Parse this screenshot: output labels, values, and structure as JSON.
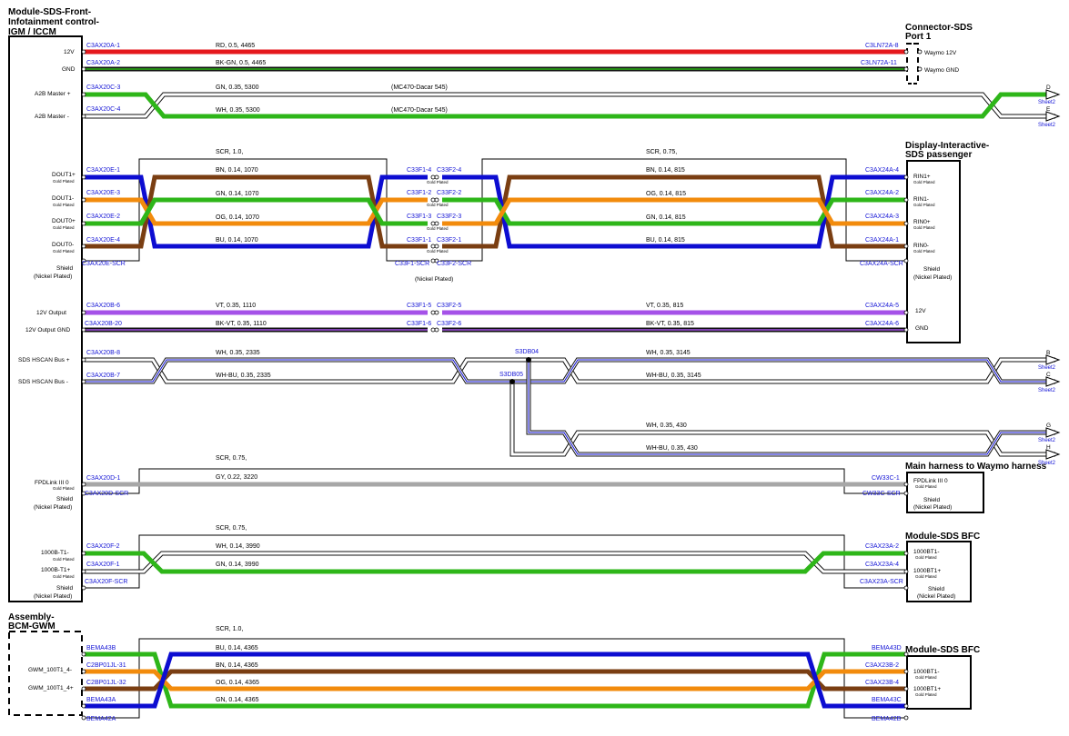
{
  "colors": {
    "red": "#e5191d",
    "black": "#111111",
    "green": "#2eb619",
    "white_wire": "#ffffff",
    "brown": "#7a3e12",
    "orange": "#f28b0c",
    "blue": "#0d0dd1",
    "violet": "#a552e8",
    "gray": "#a7a7a7",
    "pin_text": "#1515d6"
  },
  "components": {
    "igm": {
      "title_1": "Module-SDS-Front-",
      "title_2": "Infotainment control-",
      "title_3": "IGM / ICCM"
    },
    "conn_sds": {
      "title_1": "Connector-SDS",
      "title_2": "Port 1",
      "pin_1": "Waymo 12V",
      "pin_2": "Waymo GND"
    },
    "display": {
      "title_1": "Display-Interactive-",
      "title_2": "SDS passenger",
      "rin1p": "RIN1+",
      "rin1n": "RIN1-",
      "rin0p": "RIN0+",
      "rin0n": "RIN0-",
      "shield": "Shield",
      "shield_sub": "(Nickel Plated)",
      "v12": "12V",
      "gnd": "GND"
    },
    "waymo": {
      "title": "Main harness to Waymo harness",
      "fpd": "FPDLink III 0",
      "fpd_sub": "Gold Plated",
      "shield": "Shield",
      "shield_sub": "(Nickel Plated)"
    },
    "bfc1": {
      "title": "Module-SDS BFC",
      "t1n": "1000BT1-",
      "t1p": "1000BT1+",
      "sub": "Gold Plated",
      "shield": "Shield",
      "shield_sub": "(Nickel Plated)"
    },
    "bcm": {
      "title_1": "Assembly-",
      "title_2": "BCM-GWM",
      "p1": "GWM_100T1_4-",
      "p2": "GWM_100T1_4+"
    },
    "bfc2": {
      "title": "Module-SDS BFC",
      "t1n": "1000BT1-",
      "t1p": "1000BT1+",
      "sub": "Gold Plated"
    }
  },
  "igm_pins": {
    "v12": "12V",
    "gnd": "GND",
    "a2bp": "A2B Master +",
    "a2bn": "A2B Master -",
    "dout1p": "DOUT1+",
    "dout1n": "DOUT1-",
    "dout0p": "DOUT0+",
    "dout0n": "DOUT0-",
    "gold": "Gold Plated",
    "shield": "Shield",
    "nickel": "(Nickel Plated)",
    "out12": "12V Output",
    "outgnd": "12V Output GND",
    "canp": "SDS HSCAN Bus +",
    "cann": "SDS HSCAN Bus -",
    "fpd": "FPDLink III 0",
    "t1n": "1000B-T1-",
    "t1p": "1000B-T1+"
  },
  "pins": {
    "a20a1": "C3AX20A-1",
    "a20a2": "C3AX20A-2",
    "ln8": "C3LN72A-8",
    "ln11": "C3LN72A-11",
    "c3": "C3AX20C-3",
    "c4": "C3AX20C-4",
    "e1": "C3AX20E-1",
    "e3": "C3AX20E-3",
    "e2": "C3AX20E-2",
    "e4": "C3AX20E-4",
    "escr": "C3AX20E-SCR",
    "f14": "C33F1-4",
    "f24": "C33F2-4",
    "f12": "C33F1-2",
    "f22": "C33F2-2",
    "f13": "C33F1-3",
    "f23": "C33F2-3",
    "f11": "C33F1-1",
    "f21": "C33F2-1",
    "f1scr": "C33F1-SCR",
    "f2scr": "C33F2-SCR",
    "gold": "Gold Plated",
    "nickel": "(Nickel Plated)",
    "a4": "C3AX24A-4",
    "a2": "C3AX24A-2",
    "a3": "C3AX24A-3",
    "a1": "C3AX24A-1",
    "ascr": "C3AX24A-SCR",
    "b6": "C3AX20B-6",
    "b20": "C3AX20B-20",
    "f15": "C33F1-5",
    "f25": "C33F2-5",
    "f16": "C33F1-6",
    "f26": "C33F2-6",
    "a5": "C3AX24A-5",
    "a6": "C3AX24A-6",
    "b8": "C3AX20B-8",
    "b7": "C3AX20B-7",
    "s3db04": "S3DB04",
    "s3db05": "S3DB05",
    "d1": "C3AX20D-1",
    "dscr": "C3AX20D-SCR",
    "cw1": "CW33C-1",
    "cwscr": "CW33C-SCR",
    "f2": "C3AX20F-2",
    "f1": "C3AX20F-1",
    "fscr": "C3AX20F-SCR",
    "a232": "C3AX23A-2",
    "a234": "C3AX23A-4",
    "a23scr": "C3AX23A-SCR",
    "m43b": "BEMA43B",
    "c31": "C2BP01JL-31",
    "c32": "C2BP01JL-32",
    "m43a": "BEMA43A",
    "m42a": "BEMA42A",
    "m43d": "BEMA43D",
    "b232": "C3AX23B-2",
    "b234": "C3AX23B-4",
    "m43c": "BEMA43C",
    "m42b": "BEMA42B"
  },
  "wires": {
    "rd": "RD,  0.5,  4465",
    "bkgn": "BK-GN,  0.5,  4465",
    "gn_a2b": "GN,  0.35,  5300",
    "wh_a2b": "WH,  0.35,  5300",
    "mc1": "(MC470-Dacar 545)",
    "mc2": "(MC470-Dacar 545)",
    "scr1": "SCR,  1.0,",
    "bn1": "BN,  0.14,  1070",
    "gn1": "GN,  0.14,  1070",
    "og1": "OG,  0.14,  1070",
    "bu1": "BU,  0.14,  1070",
    "scr2": "SCR,  0.75,",
    "bn2": "BN,  0.14,  815",
    "og2": "OG,  0.14,  815",
    "gn2": "GN,  0.14,  815",
    "bu2": "BU,  0.14,  815",
    "vt1": "VT,  0.35,  1110",
    "bkvt1": "BK-VT,  0.35,  1110",
    "vt2": "VT,  0.35,  815",
    "bkvt2": "BK-VT,  0.35,  815",
    "wh1": "WH,  0.35,  2335",
    "whbu1": "WH-BU,  0.35,  2335",
    "wh2": "WH,  0.35,  3145",
    "whbu2": "WH-BU,  0.35,  3145",
    "wh3": "WH,  0.35,  430",
    "whbu3": "WH-BU,  0.35,  430",
    "scr3": "SCR,  0.75,",
    "gy": "GY,  0.22,  3220",
    "scr4": "SCR,  0.75,",
    "wh_t1": "WH,  0.14,  3990",
    "gn_t1": "GN,  0.14,  3990",
    "scr5": "SCR,  1.0,",
    "bu5": "BU,  0.14,  4365",
    "bn5": "BN,  0.14,  4365",
    "og5": "OG,  0.14,  4365",
    "gn5": "GN,  0.14,  4365"
  },
  "sheet_refs": {
    "d": "D",
    "e": "E",
    "b": "B",
    "c": "C",
    "g": "G",
    "h": "H",
    "sheet": "Sheet2"
  }
}
